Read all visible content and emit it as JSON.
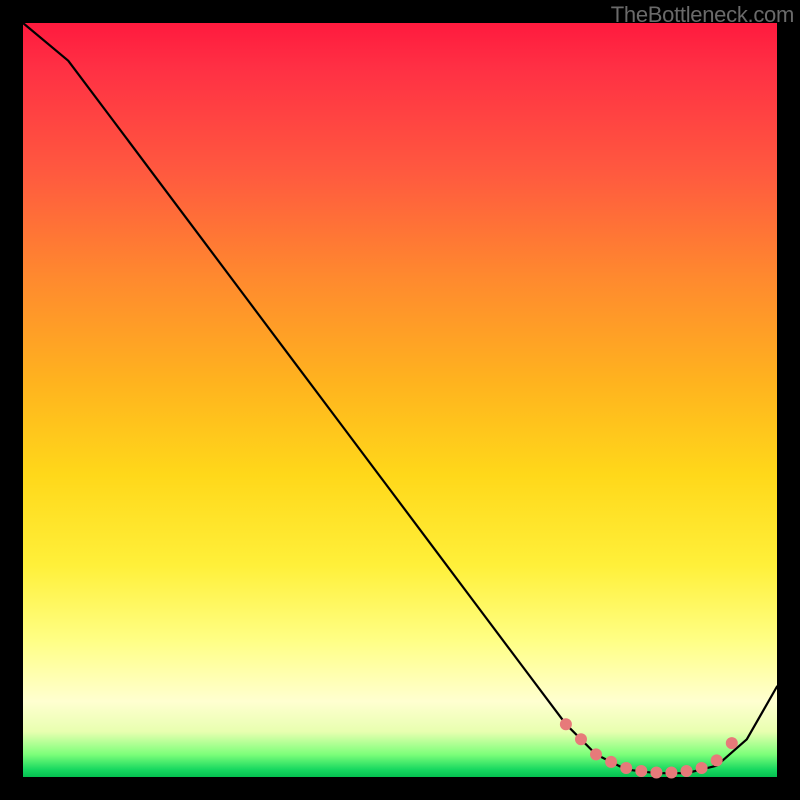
{
  "watermark": "TheBottleneck.com",
  "chart_data": {
    "type": "line",
    "title": "",
    "xlabel": "",
    "ylabel": "",
    "xlim": [
      0,
      100
    ],
    "ylim": [
      0,
      100
    ],
    "series": [
      {
        "name": "bottleneck-curve",
        "x": [
          0,
          6,
          12,
          18,
          24,
          30,
          36,
          42,
          48,
          54,
          60,
          66,
          72,
          76,
          80,
          84,
          88,
          92,
          96,
          100
        ],
        "y": [
          100,
          95,
          87,
          79,
          71,
          63,
          55,
          47,
          39,
          31,
          23,
          15,
          7,
          3,
          1,
          0.5,
          0.5,
          1.5,
          5,
          12
        ]
      }
    ],
    "markers": {
      "name": "highlight-dots",
      "color": "#e77a7a",
      "x": [
        72,
        74,
        76,
        78,
        80,
        82,
        84,
        86,
        88,
        90,
        92,
        94
      ],
      "y": [
        7,
        5,
        3,
        2,
        1.2,
        0.8,
        0.6,
        0.6,
        0.8,
        1.2,
        2.2,
        4.5
      ]
    }
  }
}
